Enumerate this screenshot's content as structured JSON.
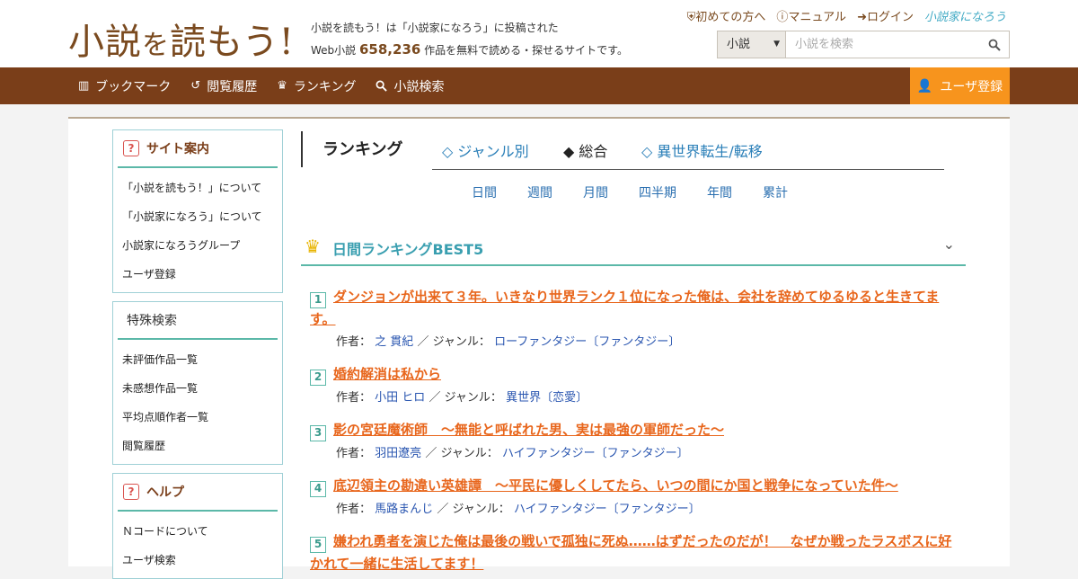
{
  "header": {
    "logo": {
      "part1": "小説",
      "part2": "を",
      "part3": "読もう!"
    },
    "tagline": {
      "line1": "小説を読もう！は「小説家になろう」に投稿された",
      "line2_pre": "Web小説",
      "count": "658,236",
      "line2_post": "作品を無料で読める・探せるサイトです。"
    },
    "links": {
      "first_time": "初めての方へ",
      "manual": "マニュアル",
      "login": "ログイン",
      "partner": "小説家になろう"
    },
    "search": {
      "category": "小説",
      "placeholder": "小説を検索"
    }
  },
  "nav": {
    "items": [
      {
        "label": "ブックマーク",
        "icon": "bookmark-icon"
      },
      {
        "label": "閲覧履歴",
        "icon": "history-icon"
      },
      {
        "label": "ランキング",
        "icon": "crown-icon"
      },
      {
        "label": "小説検索",
        "icon": "search-icon"
      }
    ],
    "register": "ユーザ登録"
  },
  "sidebar": {
    "site_guide": {
      "title": "サイト案内",
      "items": [
        "「小説を読もう！」について",
        "「小説家になろう」について",
        "小説家になろうグループ",
        "ユーザ登録"
      ]
    },
    "special_search": {
      "title": "特殊検索",
      "items": [
        "未評価作品一覧",
        "未感想作品一覧",
        "平均点順作者一覧",
        "閲覧履歴"
      ]
    },
    "help": {
      "title": "ヘルプ",
      "items": [
        "Ｎコードについて",
        "ユーザ検索"
      ]
    }
  },
  "main": {
    "title": "ランキング",
    "tabs": [
      {
        "label": "◇ ジャンル別",
        "active": false
      },
      {
        "label": "◆ 総合",
        "active": true
      },
      {
        "label": "◇ 異世界転生/転移",
        "active": false
      }
    ],
    "periods": [
      "日間",
      "週間",
      "月間",
      "四半期",
      "年間",
      "累計"
    ],
    "section_title": "日間ランキングBEST5",
    "labels": {
      "author": "作者：",
      "genre": "／ ジャンル："
    },
    "ranking": [
      {
        "rank": "1",
        "title": "ダンジョンが出来て３年。いきなり世界ランク１位になった俺は、会社を辞めてゆるゆると生きてます。",
        "author": "之 貫紀",
        "genre": "ローファンタジー〔ファンタジー〕"
      },
      {
        "rank": "2",
        "title": "婚約解消は私から",
        "author": "小田 ヒロ",
        "genre": "異世界〔恋愛〕"
      },
      {
        "rank": "3",
        "title": "影の宮廷魔術師　～無能と呼ばれた男、実は最強の軍師だった～",
        "author": "羽田遼亮",
        "genre": "ハイファンタジー〔ファンタジー〕"
      },
      {
        "rank": "4",
        "title": "底辺領主の勘違い英雄譚　～平民に優しくしてたら、いつの間にか国と戦争になっていた件～",
        "author": "馬路まんじ",
        "genre": "ハイファンタジー〔ファンタジー〕"
      },
      {
        "rank": "5",
        "title": "嫌われ勇者を演じた俺は最後の戦いで孤独に死ぬ……はずだったのだが！　なぜか戦ったラスボスに好かれて一緒に生活してます！",
        "author": "",
        "genre": ""
      }
    ]
  },
  "colors": {
    "brand_brown": "#7a3e19",
    "accent_orange": "#f7941d",
    "title_orange": "#e8661c",
    "teal": "#5bb8a8",
    "link_blue": "#2a56b0"
  }
}
